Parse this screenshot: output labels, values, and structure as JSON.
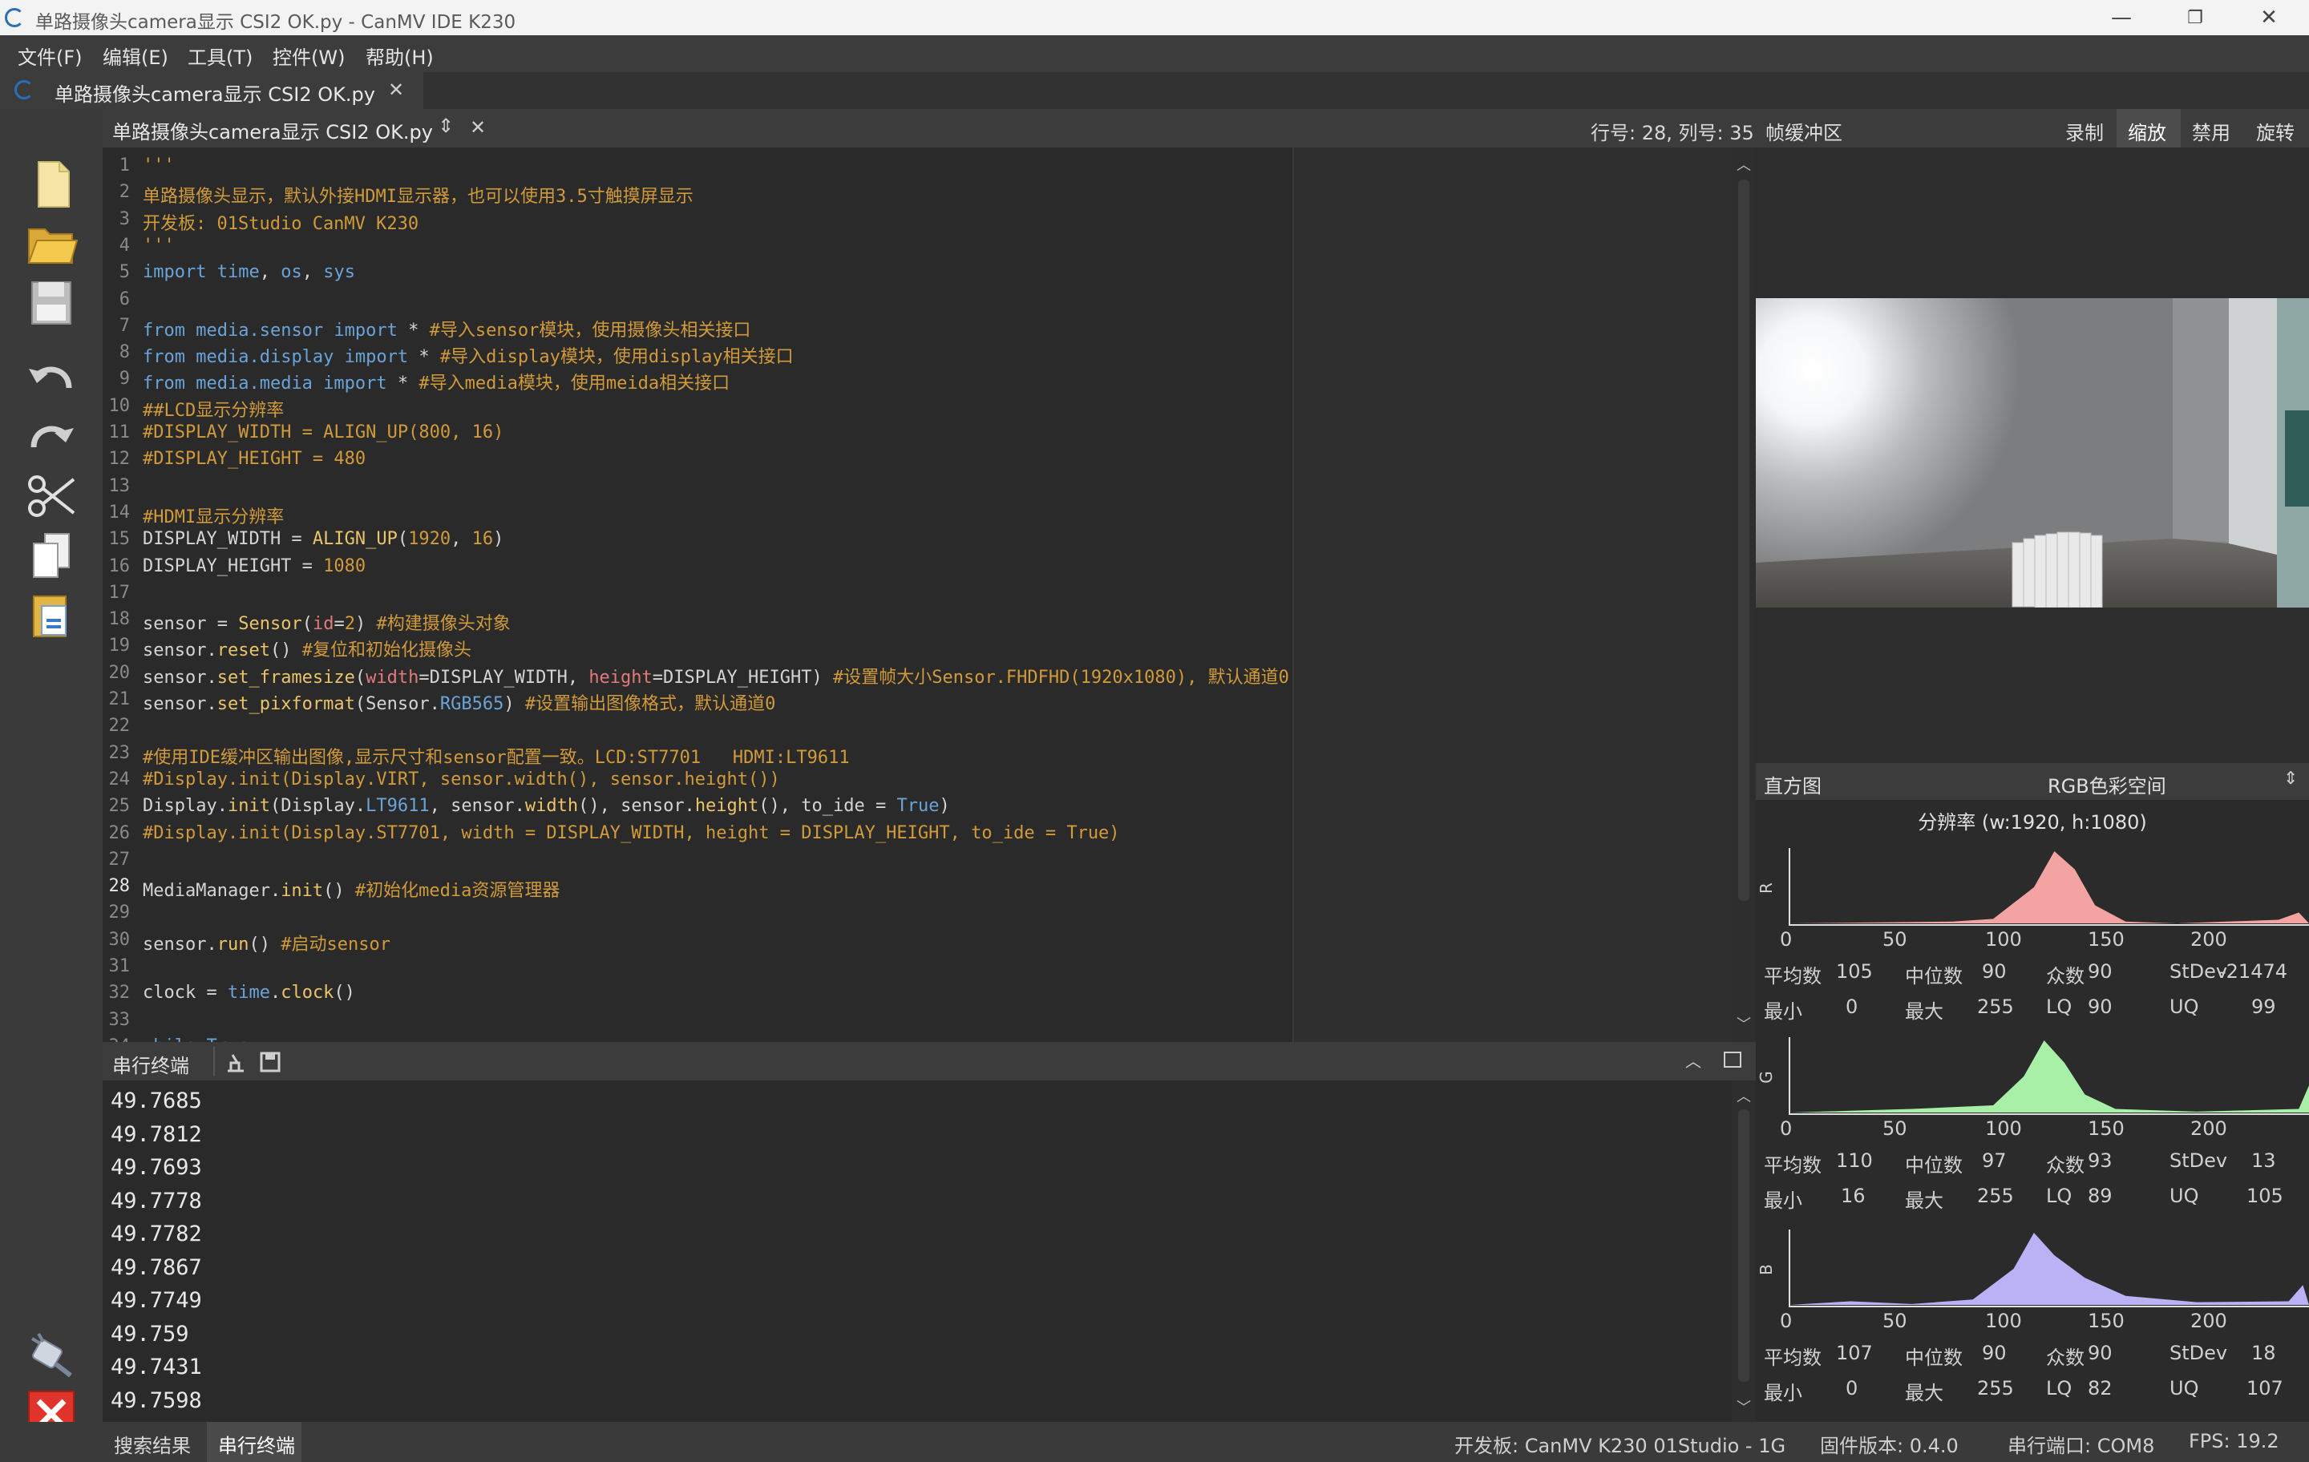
{
  "window": {
    "title": "单路摄像头camera显示 CSI2 OK.py - CanMV IDE K230",
    "minimize": "—",
    "restore": "❐",
    "close": "✕"
  },
  "menu": [
    "文件(F)",
    "编辑(E)",
    "工具(T)",
    "控件(W)",
    "帮助(H)"
  ],
  "file_tab": {
    "label": "单路摄像头camera显示 CSI2 OK.py",
    "close": "✕"
  },
  "editor_header": {
    "file": "单路摄像头camera显示 CSI2 OK.py",
    "updown": "⇕",
    "close": "✕",
    "position": "行号: 28, 列号: 35"
  },
  "editor": {
    "lines": [
      "'''",
      "单路摄像头显示，默认外接HDMI显示器，也可以使用3.5寸触摸屏显示",
      "开发板: 01Studio CanMV K230",
      "'''",
      "import time, os, sys",
      "",
      "from media.sensor import * #导入sensor模块，使用摄像头相关接口",
      "from media.display import * #导入display模块，使用display相关接口",
      "from media.media import * #导入media模块，使用meida相关接口",
      "##LCD显示分辨率",
      "#DISPLAY_WIDTH = ALIGN_UP(800, 16)",
      "#DISPLAY_HEIGHT = 480",
      "",
      "#HDMI显示分辨率",
      "DISPLAY_WIDTH = ALIGN_UP(1920, 16)",
      "DISPLAY_HEIGHT = 1080",
      "",
      "sensor = Sensor(id=2) #构建摄像头对象",
      "sensor.reset() #复位和初始化摄像头",
      "sensor.set_framesize(width=DISPLAY_WIDTH, height=DISPLAY_HEIGHT) #设置帧大小Sensor.FHDFHD(1920x1080), 默认通道0",
      "sensor.set_pixformat(Sensor.RGB565) #设置输出图像格式，默认通道0",
      "",
      "#使用IDE缓冲区输出图像,显示尺寸和sensor配置一致。LCD:ST7701   HDMI:LT9611",
      "#Display.init(Display.VIRT, sensor.width(), sensor.height())",
      "Display.init(Display.LT9611, sensor.width(), sensor.height(), to_ide = True)",
      "#Display.init(Display.ST7701, width = DISPLAY_WIDTH, height = DISPLAY_HEIGHT, to_ide = True)",
      "",
      "MediaManager.init() #初始化media资源管理器",
      "",
      "sensor.run() #启动sensor",
      "",
      "clock = time.clock()",
      "",
      "while True:"
    ]
  },
  "terminal": {
    "title": "串行终端",
    "lines": [
      "49.7685",
      "49.7812",
      "49.7693",
      "49.7778",
      "49.7782",
      "49.7867",
      "49.7749",
      "49.759",
      "49.7431",
      "49.7598"
    ]
  },
  "framebuffer": {
    "title": "帧缓冲区",
    "buttons": [
      "录制",
      "缩放",
      "禁用",
      "旋转"
    ],
    "active": "缩放"
  },
  "histogram": {
    "title": "直方图",
    "colorspace": "RGB色彩空间",
    "resolution": "分辨率 (w:1920, h:1080)",
    "axis_ticks": [
      "0",
      "50",
      "100",
      "150",
      "200"
    ],
    "channels": [
      {
        "label": "R",
        "color": "#f4a3a3",
        "mean": "105",
        "median": "90",
        "mode": "90",
        "stdev": "-21474",
        "min": "0",
        "max": "255",
        "lq": "90",
        "uq": "99"
      },
      {
        "label": "G",
        "color": "#a8f0a8",
        "mean": "110",
        "median": "97",
        "mode": "93",
        "stdev": "13",
        "min": "16",
        "max": "255",
        "lq": "89",
        "uq": "105"
      },
      {
        "label": "B",
        "color": "#b9b3f5",
        "mean": "107",
        "median": "90",
        "mode": "90",
        "stdev": "18",
        "min": "0",
        "max": "255",
        "lq": "82",
        "uq": "107"
      }
    ],
    "stat_labels": {
      "mean": "平均数",
      "median": "中位数",
      "mode": "众数",
      "stdev": "StDev",
      "min": "最小",
      "max": "最大",
      "lq": "LQ",
      "uq": "UQ"
    }
  },
  "bottom_tabs": [
    "搜索结果",
    "串行终端"
  ],
  "status": {
    "board": "开发板: CanMV K230 01Studio - 1G",
    "firmware": "固件版本: 0.4.0",
    "port": "串行端口: COM8",
    "fps": "FPS: 19.2"
  }
}
